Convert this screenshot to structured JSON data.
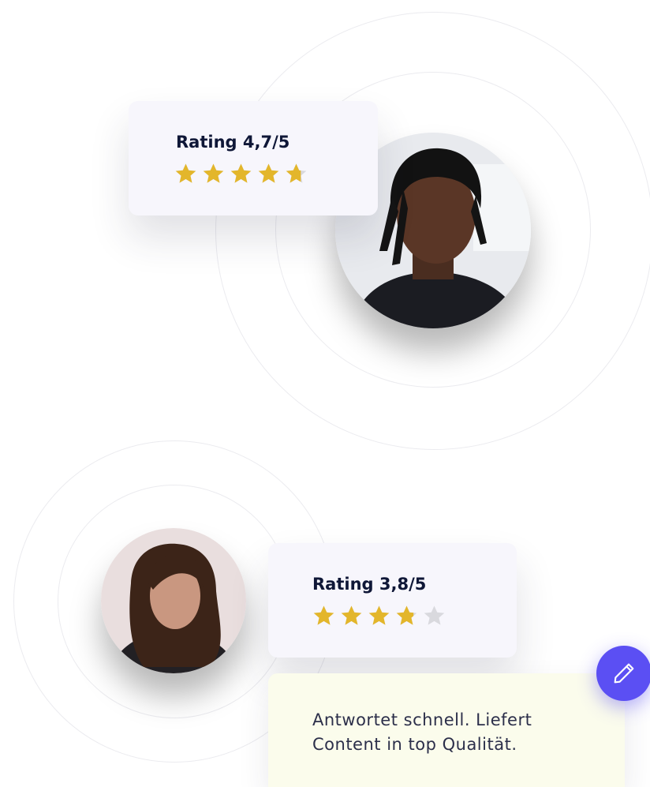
{
  "reviews": [
    {
      "rating_label": "Rating 4,7/5",
      "rating": 4.7,
      "max": 5,
      "avatar": "man-with-dreadlocks-portrait"
    },
    {
      "rating_label": "Rating 3,8/5",
      "rating": 3.8,
      "max": 5,
      "avatar": "woman-long-hair-portrait"
    }
  ],
  "comment": {
    "text": "Antwortet schnell. Liefert Content in top Qualität."
  },
  "fab": {
    "icon": "pencil-icon"
  },
  "colors": {
    "star_filled": "#e3b62b",
    "star_empty": "#d9d9de",
    "heading": "#0f1737",
    "card": "#f7f6fc",
    "comment_bg": "#fbfcec",
    "accent": "#5b4ff3"
  }
}
